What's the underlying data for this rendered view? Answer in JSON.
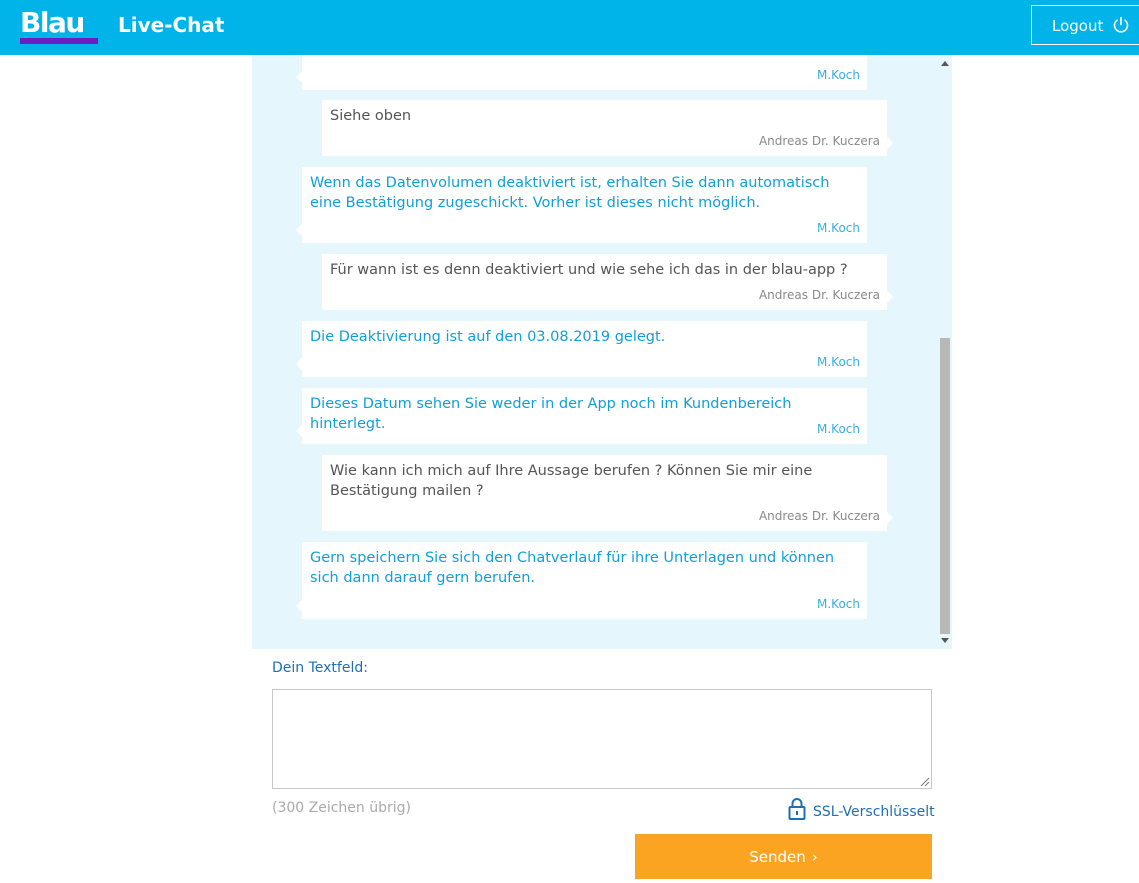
{
  "header": {
    "logo_text": "Blau",
    "title": "Live-Chat",
    "logout_label": "Logout",
    "brand_color": "#00b4ea",
    "logo_bar_color": "#6a1fc2"
  },
  "chat": {
    "messages": [
      {
        "role": "agent",
        "text": "",
        "sender": "M.Koch"
      },
      {
        "role": "user",
        "text": "Siehe oben",
        "sender": "Andreas Dr. Kuczera"
      },
      {
        "role": "agent",
        "text": "Wenn das Datenvolumen deaktiviert ist, erhalten Sie dann automatisch eine Bestätigung zugeschickt. Vorher ist dieses nicht möglich.",
        "sender": "M.Koch"
      },
      {
        "role": "user",
        "text": "Für wann ist es denn deaktiviert und wie sehe ich das in der blau-app ?",
        "sender": "Andreas Dr. Kuczera"
      },
      {
        "role": "agent",
        "text": "Die Deaktivierung ist auf den 03.08.2019 gelegt.",
        "sender": "M.Koch"
      },
      {
        "role": "agent",
        "text": "Dieses Datum sehen Sie weder in der App noch im Kundenbereich hinterlegt.",
        "sender": "M.Koch"
      },
      {
        "role": "user",
        "text": "Wie kann ich mich auf Ihre Aussage berufen ? Können Sie mir eine Bestätigung mailen ?",
        "sender": "Andreas Dr. Kuczera"
      },
      {
        "role": "agent",
        "text": "Gern speichern Sie sich den Chatverlauf für ihre Unterlagen und können sich dann darauf gern berufen.",
        "sender": "M.Koch"
      }
    ]
  },
  "form": {
    "field_label": "Dein Textfeld:",
    "textarea_value": "",
    "char_count": "(300 Zeichen übrig)",
    "ssl_label": "SSL-Verschlüsselt",
    "send_label": "Senden",
    "send_color": "#fba422"
  },
  "icons": {
    "logout": "power-icon",
    "ssl": "lock-icon",
    "send": "chevron-right-icon"
  }
}
